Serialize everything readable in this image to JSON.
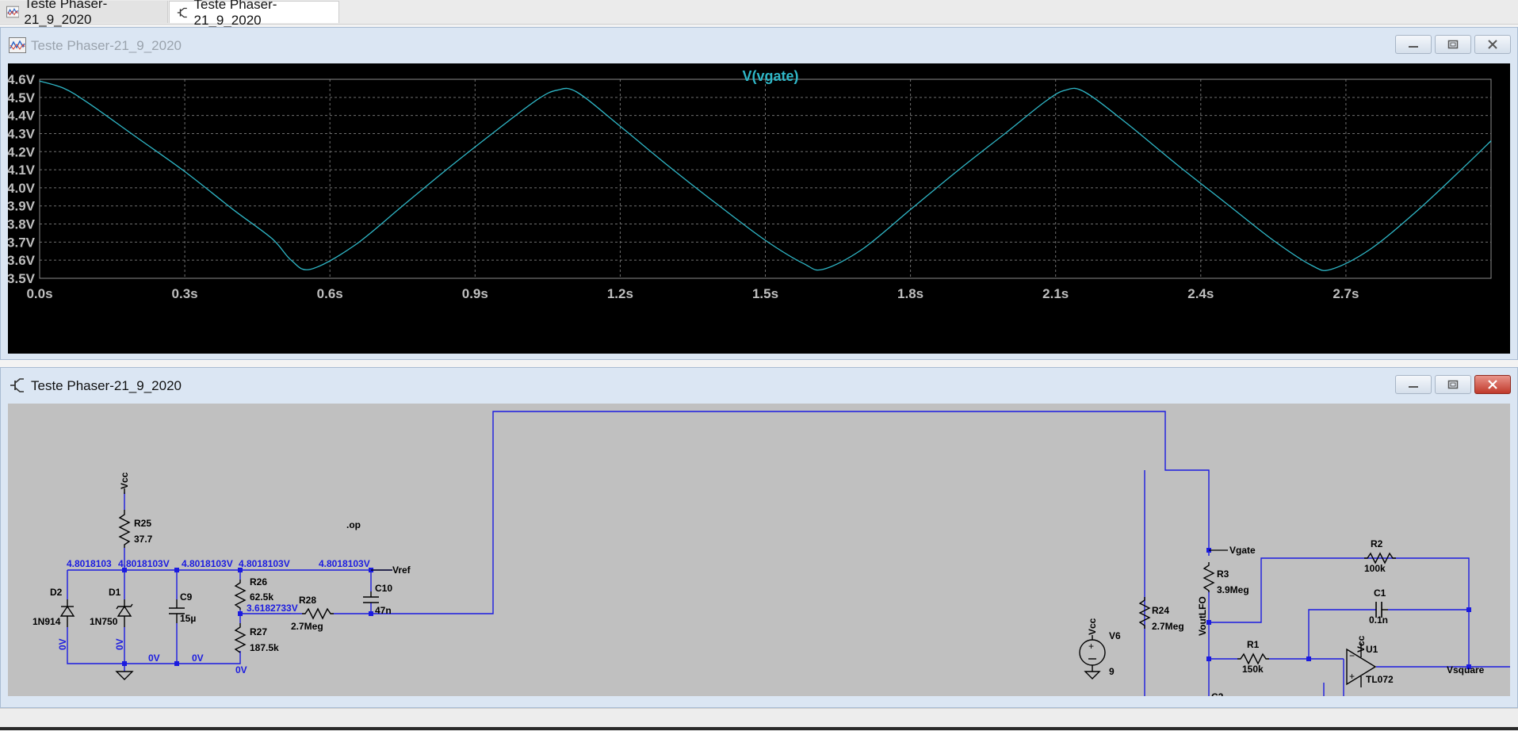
{
  "tabs": [
    {
      "label": "Teste Phaser-21_9_2020",
      "icon": "waveform-icon"
    },
    {
      "label": "Teste Phaser-21_9_2020",
      "icon": "schematic-icon"
    }
  ],
  "plot_window": {
    "title": "Teste Phaser-21_9_2020",
    "icon": "waveform-icon",
    "state": "inactive"
  },
  "schematic_window": {
    "title": "Teste Phaser-21_9_2020",
    "icon": "schematic-icon",
    "state": "active"
  },
  "colors": {
    "trace": "#2fb7c7",
    "plot_bg": "#000000",
    "grid": "#6f6f6f",
    "wire": "#1b1be0",
    "component": "#000000",
    "node_voltage": "#1b1be0",
    "schematic_bg": "#c0c0c0"
  },
  "chart_data": {
    "type": "line",
    "title": "V(vgate)",
    "xlabel": "",
    "ylabel": "",
    "xlim": [
      0.0,
      3.0
    ],
    "ylim": [
      3.5,
      4.6
    ],
    "grid": true,
    "x_ticks": [
      "0.0s",
      "0.3s",
      "0.6s",
      "0.9s",
      "1.2s",
      "1.5s",
      "1.8s",
      "2.1s",
      "2.4s",
      "2.7s"
    ],
    "y_ticks": [
      "4.6V",
      "4.5V",
      "4.4V",
      "4.3V",
      "4.2V",
      "4.1V",
      "4.0V",
      "3.9V",
      "3.8V",
      "3.7V",
      "3.6V",
      "3.5V"
    ],
    "series": [
      {
        "name": "V(vgate)",
        "x": [
          0.0,
          0.05,
          0.1,
          0.2,
          0.3,
          0.4,
          0.48,
          0.52,
          0.56,
          0.65,
          0.75,
          0.85,
          0.95,
          1.03,
          1.07,
          1.11,
          1.2,
          1.3,
          1.4,
          1.5,
          1.58,
          1.62,
          1.7,
          1.8,
          1.9,
          2.0,
          2.08,
          2.12,
          2.16,
          2.25,
          2.35,
          2.45,
          2.55,
          2.63,
          2.67,
          2.75,
          2.85,
          2.95,
          3.0
        ],
        "y": [
          4.59,
          4.55,
          4.47,
          4.28,
          4.09,
          3.88,
          3.72,
          3.6,
          3.55,
          3.68,
          3.9,
          4.12,
          4.33,
          4.49,
          4.54,
          4.53,
          4.34,
          4.12,
          3.91,
          3.71,
          3.58,
          3.55,
          3.66,
          3.88,
          4.1,
          4.31,
          4.48,
          4.54,
          4.53,
          4.35,
          4.13,
          3.92,
          3.71,
          3.57,
          3.55,
          3.66,
          3.88,
          4.13,
          4.26
        ]
      }
    ]
  },
  "schematic": {
    "labels": {
      "vcc_top": "Vcc",
      "r25": "R25",
      "r25_val": "37.7",
      "op": ".op",
      "vref": "Vref",
      "d2": "D2",
      "d2_val": "1N914",
      "d1": "D1",
      "d1_val": "1N750",
      "c9": "C9",
      "c9_val": "15µ",
      "r26": "R26",
      "r26_val": "62.5k",
      "r28": "R28",
      "r28_val": "2.7Meg",
      "c10": "C10",
      "c10_val": "47n",
      "r27": "R27",
      "r27_val": "187.5k",
      "v6": "V6",
      "v6_val": "9",
      "vcc_v6": "Vcc",
      "r24": "R24",
      "r24_val": "2.7Meg",
      "vgate": "Vgate",
      "r3": "R3",
      "r3_val": "3.9Meg",
      "voutlfo": "VoutLFO",
      "r2": "R2",
      "r2_val": "100k",
      "c1": "C1",
      "c1_val": "0.1n",
      "r1": "R1",
      "r1_val": "150k",
      "u1": "U1",
      "u1_val": "TL072",
      "vcc_u1": "Vcc",
      "vsquare": "Vsquare",
      "c2_partial": "C2"
    },
    "node_voltages": {
      "n1": "4.8018103",
      "n2": "4.8018103V",
      "n3": "4.8018103V",
      "n4": "4.8018103V",
      "n5": "4.8018103V",
      "n6": "3.6182733V",
      "zero_d2": "0V",
      "zero_d1": "0V",
      "zero_gnd1": "0V",
      "zero_gnd2": "0V",
      "zero_r27": "0V"
    }
  }
}
